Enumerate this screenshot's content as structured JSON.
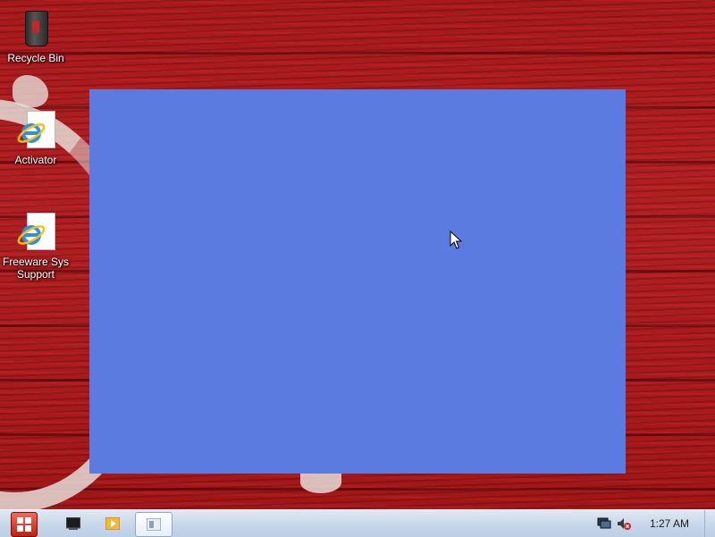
{
  "desktop": {
    "icons": [
      {
        "label": "Recycle Bin",
        "icon": "recycle-bin-icon"
      },
      {
        "label": "Activator",
        "icon": "internet-explorer-shortcut-icon"
      },
      {
        "label": "Freeware Sys Support",
        "icon": "internet-explorer-shortcut-icon"
      }
    ]
  },
  "window": {
    "color": "#5b7be0"
  },
  "taskbar": {
    "start_icon": "windows-logo-icon",
    "pinned": [
      {
        "icon": "terminal-icon"
      },
      {
        "icon": "media-player-icon"
      },
      {
        "icon": "window-app-icon",
        "active": true
      }
    ],
    "tray": [
      {
        "icon": "network-icon"
      },
      {
        "icon": "volume-muted-icon"
      }
    ],
    "clock": "1:27 AM"
  },
  "colors": {
    "wallpaper": "#a8191b",
    "taskbar": "#c9d8ea",
    "start_button": "#c21f12"
  }
}
